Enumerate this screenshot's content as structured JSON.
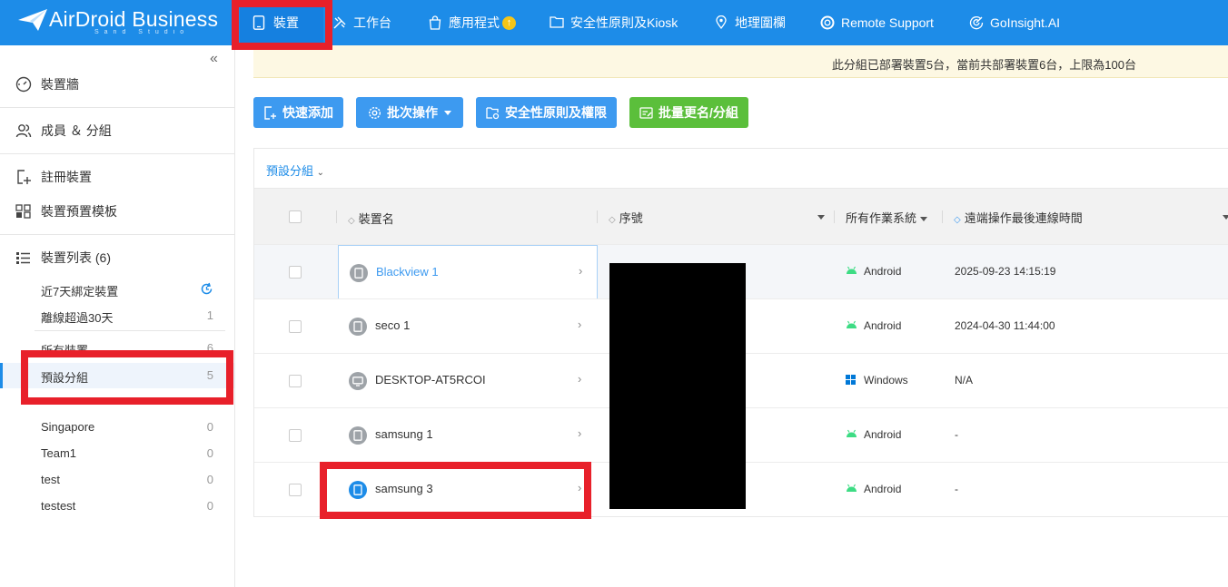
{
  "topnav": {
    "logo_text": "AirDroid Business",
    "logo_sub": "Sand Studio",
    "items": [
      {
        "label": "裝置",
        "icon": "tablet-icon"
      },
      {
        "label": "工作台",
        "icon": "tools-icon"
      },
      {
        "label": "應用程式",
        "icon": "bag-icon"
      },
      {
        "label": "安全性原則及Kiosk",
        "icon": "folder-icon"
      },
      {
        "label": "地理圍欄",
        "icon": "map-pin-icon"
      },
      {
        "label": "Remote Support",
        "icon": "lifebuoy-icon"
      },
      {
        "label": "GoInsight.AI",
        "icon": "target-icon"
      }
    ]
  },
  "sidebar": {
    "main_items": [
      {
        "label": "裝置牆"
      },
      {
        "label": "成員 ＆ 分組"
      },
      {
        "label": "註冊裝置"
      },
      {
        "label": "裝置預置模板"
      },
      {
        "label": "裝置列表 (6)"
      }
    ],
    "sub_items": [
      {
        "label": "近7天綁定裝置",
        "count": ""
      },
      {
        "label": "離線超過30天",
        "count": "1"
      },
      {
        "label": "所有裝置",
        "count": "6"
      },
      {
        "label": "預設分組",
        "count": "5"
      },
      {
        "label": "Singapore",
        "count": "0"
      },
      {
        "label": "Team1",
        "count": "0"
      },
      {
        "label": "test",
        "count": "0"
      },
      {
        "label": "testest",
        "count": "0"
      }
    ]
  },
  "notice": "此分組已部署裝置5台，當前共部署裝置6台，上限為100台",
  "toolbar": {
    "quick_add": "快速添加",
    "batch_ops": "批次操作",
    "policy": "安全性原則及權限",
    "batch_rename": "批量更名/分組"
  },
  "group_selector": "預設分組",
  "table": {
    "headers": {
      "name": "裝置名",
      "serial": "序號",
      "os": "所有作業系統",
      "last_conn": "遠端操作最後連線時間"
    },
    "rows": [
      {
        "name": "Blackview 1",
        "os": "Android",
        "time": "2025-09-23 14:15:19"
      },
      {
        "name": "seco 1",
        "os": "Android",
        "time": "2024-04-30 11:44:00"
      },
      {
        "name": "DESKTOP-AT5RCOI",
        "os": "Windows",
        "time": "N/A"
      },
      {
        "name": "samsung 1",
        "os": "Android",
        "time": "-"
      },
      {
        "name": "samsung 3",
        "os": "Android",
        "time": "-"
      }
    ]
  },
  "colors": {
    "brand_blue": "#1d8ce8",
    "button_blue": "#3d9af0",
    "button_green": "#5bbf3b",
    "annotation_red": "#e8202a",
    "android_green": "#3ddc84",
    "windows_blue": "#0078d7"
  }
}
